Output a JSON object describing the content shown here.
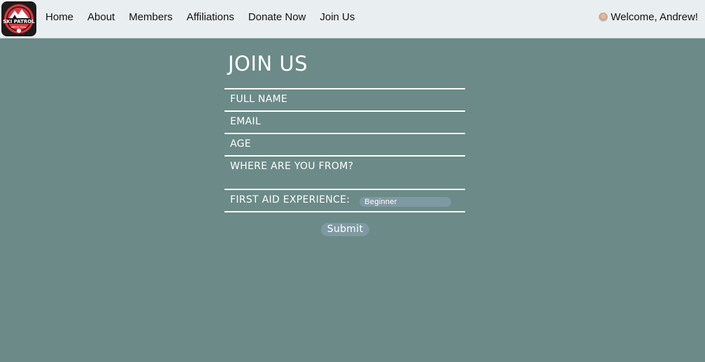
{
  "nav": {
    "logo_text": "SKI PATROL",
    "logo_subtext": "BRYCE PEAK",
    "links": [
      "Home",
      "About",
      "Members",
      "Affiliations",
      "Donate Now",
      "Join Us"
    ],
    "welcome": "Welcome, Andrew!"
  },
  "form": {
    "title": "JOIN US",
    "full_name": "FULL NAME",
    "email": "EMAIL",
    "age": "AGE",
    "from": "WHERE ARE YOU FROM?",
    "first_aid": "FIRST AID EXPERIENCE:",
    "first_aid_value": "Beginner",
    "submit": "Submit"
  },
  "colors": {
    "background": "#6b8a88",
    "navbar": "#e9eef0",
    "control": "#7e99a2",
    "logo_red": "#d9363e"
  }
}
